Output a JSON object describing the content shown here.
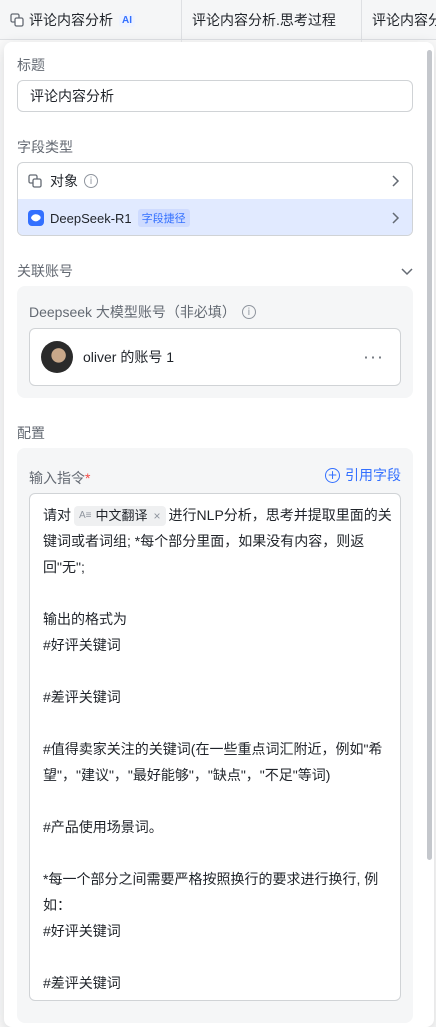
{
  "sheet": {
    "columns": [
      "评论内容分析",
      "评论内容分析.思考过程",
      "评论内容分"
    ],
    "ai_badge": "AI"
  },
  "panel": {
    "title_label": "标题",
    "title_value": "评论内容分析",
    "field_type_label": "字段类型",
    "type_object": "对象",
    "model_name": "DeepSeek-R1",
    "model_tag": "字段捷径",
    "linked_account_label": "关联账号",
    "account_hint": "Deepseek 大模型账号（非必填）",
    "account_name": "oliver 的账号 1",
    "config_label": "配置",
    "prompt_label": "输入指令",
    "required_mark": "*",
    "ref_field_label": "引用字段",
    "chip_ai": "A≡",
    "chip_label": "中文翻译",
    "chip_close": "×",
    "prompt_before_chip": "请对",
    "prompt_after_chip": "进行NLP分析，思考并提取里面的关",
    "prompt_lines": [
      "键词或者词组; *每个部分里面，如果没有内容，则返",
      "回\"无\";",
      "",
      "输出的格式为",
      "#好评关键词",
      "",
      "#差评关键词",
      "",
      "#值得卖家关注的关键词(在一些重点词汇附近，例如\"希",
      "望\"，\"建议\"，\"最好能够\"，\"缺点\"，\"不足\"等词)",
      "",
      "#产品使用场景词。",
      "",
      "*每一个部分之间需要严格按照换行的要求进行换行, 例",
      "如：",
      "#好评关键词",
      "",
      "#差评关键词"
    ]
  }
}
